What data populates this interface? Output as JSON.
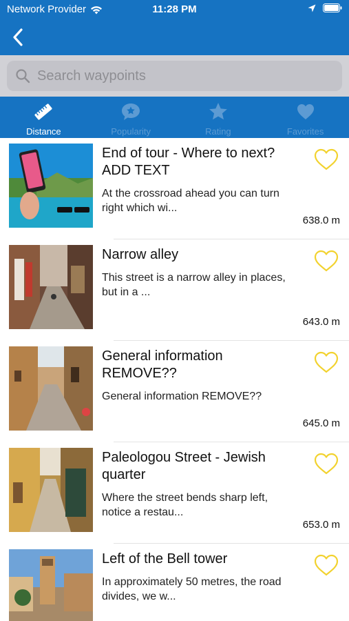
{
  "status": {
    "carrier": "Network Provider",
    "time": "11:28 PM"
  },
  "nav": {
    "back_icon": "chevron-left-icon"
  },
  "search": {
    "placeholder": "Search waypoints"
  },
  "tabs": [
    {
      "label": "Distance",
      "icon": "ruler-icon",
      "active": true
    },
    {
      "label": "Popularity",
      "icon": "star-bubble-icon",
      "active": false
    },
    {
      "label": "Rating",
      "icon": "star-icon",
      "active": false
    },
    {
      "label": "Favorites",
      "icon": "heart-icon",
      "active": false
    }
  ],
  "waypoints": [
    {
      "title": "End of tour - Where to next? ADD TEXT",
      "description": "At the crossroad ahead you can turn right which wi...",
      "distance": "638.0 m"
    },
    {
      "title": "Narrow alley",
      "description": "This street is a narrow alley in places, but in a ...",
      "distance": "643.0 m"
    },
    {
      "title": "General information REMOVE??",
      "description": "General information REMOVE??",
      "distance": "645.0 m"
    },
    {
      "title": "Paleologou Street - Jewish quarter",
      "description": "Where the street bends sharp left, notice a restau...",
      "distance": "653.0 m"
    },
    {
      "title": "Left of the Bell tower",
      "description": "In approximately 50 metres, the road divides, we w...",
      "distance": ""
    }
  ],
  "colors": {
    "brand": "#1673c2",
    "heart": "#f2d22e",
    "inactive_tab": "#5d9bd3"
  }
}
